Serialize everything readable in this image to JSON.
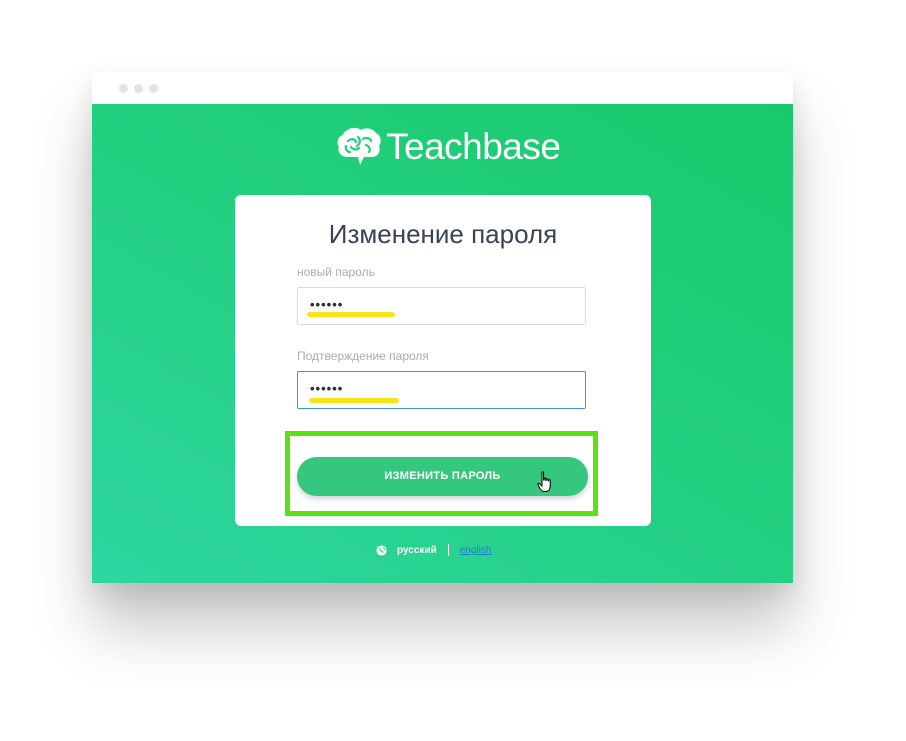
{
  "app": {
    "name": "Teachbase",
    "logo_icon": "brain-chat-icon"
  },
  "form": {
    "title": "Изменение пароля",
    "new_password": {
      "label": "новый пароль",
      "value": "••••••"
    },
    "confirm_password": {
      "label": "Подтверждение пароля",
      "value": "••••••"
    },
    "submit_label": "ИЗМЕНИТЬ ПАРОЛЬ"
  },
  "language": {
    "icon": "globe-icon",
    "current": "русский",
    "alternate": "english"
  },
  "colors": {
    "brand_green": "#22cf7d",
    "button": "#36c77e",
    "highlight_frame": "#5ce210",
    "link": "#1e7fd0",
    "text_highlight": "#f6e31a"
  }
}
